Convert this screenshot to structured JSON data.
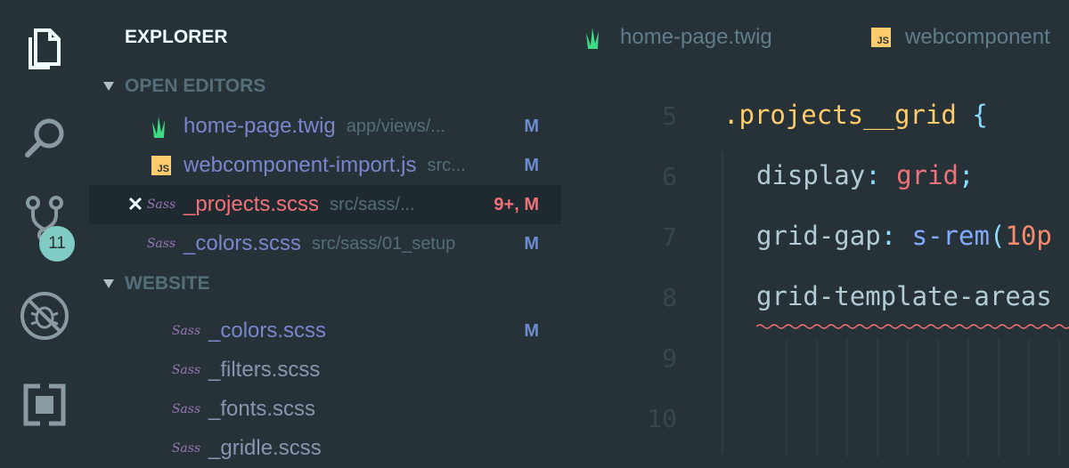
{
  "activity_bar": {
    "items": [
      {
        "name": "explorer",
        "icon": "files-icon"
      },
      {
        "name": "search",
        "icon": "search-icon"
      },
      {
        "name": "source-control",
        "icon": "source-control-icon",
        "badge": "11"
      },
      {
        "name": "debug",
        "icon": "debug-icon"
      },
      {
        "name": "extensions",
        "icon": "extensions-icon"
      }
    ]
  },
  "sidebar": {
    "title": "EXPLORER",
    "open_editors": {
      "title": "OPEN EDITORS",
      "items": [
        {
          "name": "home-page.twig",
          "path": "app/views/...",
          "status": "M",
          "icon": "twig-icon"
        },
        {
          "name": "webcomponent-import.js",
          "path": "src...",
          "status": "M",
          "icon": "js-icon"
        },
        {
          "name": "_projects.scss",
          "path": "src/sass/...",
          "status": "9+, M",
          "icon": "sass-icon",
          "close": "✕"
        },
        {
          "name": "_colors.scss",
          "path": "src/sass/01_setup",
          "status": "M",
          "icon": "sass-icon"
        }
      ]
    },
    "website": {
      "title": "WEBSITE",
      "items": [
        {
          "name": "_colors.scss",
          "status": "M"
        },
        {
          "name": "_filters.scss",
          "status": ""
        },
        {
          "name": "_fonts.scss",
          "status": ""
        },
        {
          "name": "_gridle.scss",
          "status": ""
        }
      ]
    }
  },
  "editor": {
    "tabs": [
      {
        "label": "home-page.twig",
        "icon": "twig-icon"
      },
      {
        "label": "webcomponent",
        "icon": "js-icon"
      }
    ],
    "lines": [
      {
        "num": "5",
        "selector": ".projects__grid",
        "brace": " {"
      },
      {
        "num": "6",
        "prop": "display",
        "colon": ":",
        "value": "grid",
        "semi": ";"
      },
      {
        "num": "7",
        "prop": "grid-gap",
        "colon": ":",
        "fn": "s-rem",
        "paren": "(",
        "arg": "10p"
      },
      {
        "num": "8",
        "prop": "grid-template-areas"
      },
      {
        "num": "9"
      },
      {
        "num": "10"
      }
    ]
  },
  "colors": {
    "background": "#263238",
    "selected_row": "#1f2a30",
    "modified": "#7986cb",
    "error": "#f07178",
    "badge": "#80cbc4"
  }
}
